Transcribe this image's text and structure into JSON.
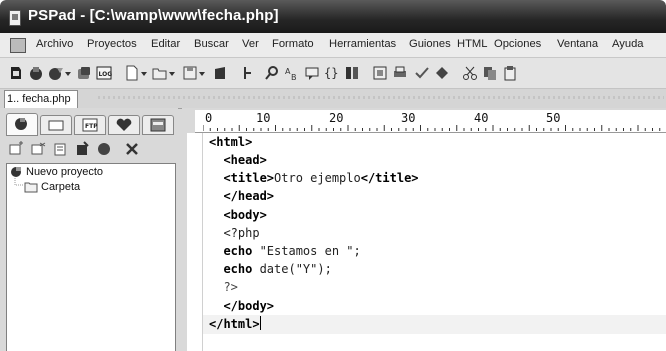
{
  "window": {
    "title": "PSPad - [C:\\wamp\\www\\fecha.php]"
  },
  "menu": {
    "items": [
      "Archivo",
      "Proyectos",
      "Editar",
      "Buscar",
      "Ver",
      "Formato",
      "Herramientas",
      "Guiones",
      "HTML",
      "Opciones",
      "Ventana",
      "Ayuda"
    ]
  },
  "tabs": {
    "active": "1.. fecha.php"
  },
  "project": {
    "root": "Nuevo proyecto",
    "folder": "Carpeta"
  },
  "ruler": {
    "marks": [
      "0",
      "10",
      "20",
      "30",
      "40",
      "50"
    ]
  },
  "editor": {
    "lines": [
      {
        "tag": "<html>",
        "text": ""
      },
      {
        "tag": "  <head>",
        "text": ""
      },
      {
        "tag": "  <title>",
        "text": "Otro ejemplo",
        "tag2": "</title>"
      },
      {
        "tag": "  </head>",
        "text": ""
      },
      {
        "tag": "  <body>",
        "text": ""
      },
      {
        "tag": "",
        "text": "  <?php"
      },
      {
        "tag": "  echo",
        "text": " \"Estamos en \";"
      },
      {
        "tag": "  echo",
        "text": " date(\"Y\");"
      },
      {
        "tag": "",
        "text": "  ?>"
      },
      {
        "tag": "  </body>",
        "text": ""
      },
      {
        "tag": "</html>",
        "text": ""
      }
    ]
  },
  "icons": {
    "titlebar": "pspad-app-icon",
    "toolbar": [
      "open-icon",
      "save-all-icon",
      "new-icon",
      "reload-icon",
      "log-icon",
      "new-file-icon",
      "open-file-icon",
      "save-icon",
      "bookmark-icon",
      "pipe-icon",
      "search-icon",
      "replace-icon",
      "comment-icon",
      "braces-icon",
      "book-icon",
      "preview-icon",
      "print-icon",
      "check-icon",
      "html-icon",
      "cut-icon",
      "copy-icon",
      "paste-icon"
    ],
    "side_tabs": [
      "project-tab-icon",
      "files-tab-icon",
      "ftp-tab-icon",
      "favorites-tab-icon",
      "explorer-tab-icon"
    ],
    "side_tools": [
      "new-project-icon",
      "add-file-icon",
      "add-folder-icon",
      "remove-icon",
      "record-icon",
      "settings-icon"
    ]
  }
}
